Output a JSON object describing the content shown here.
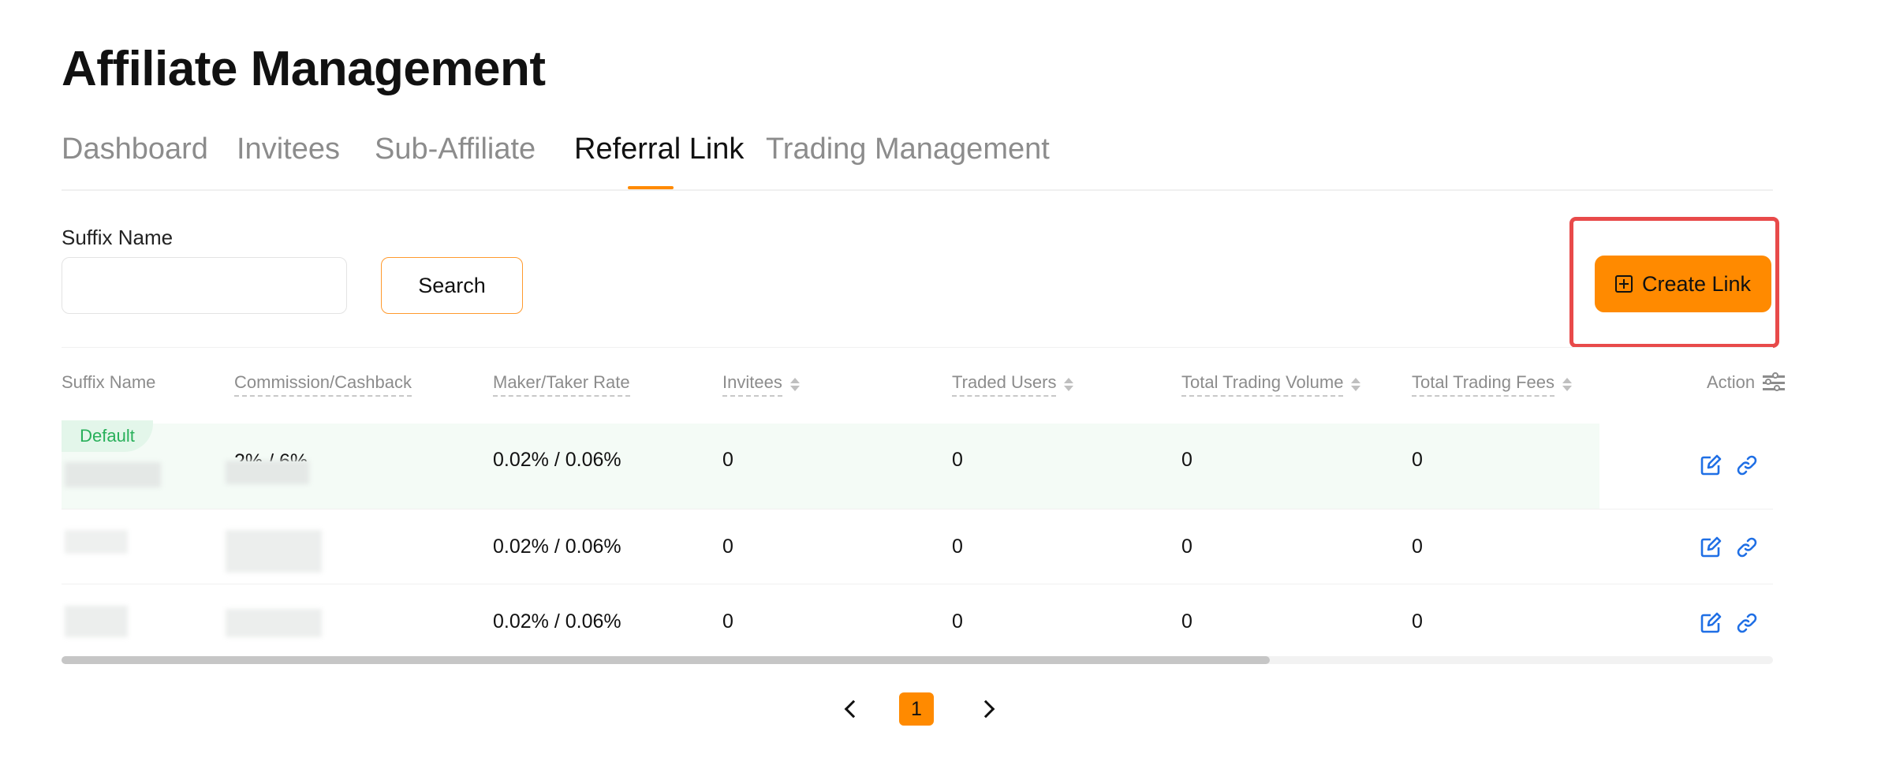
{
  "page": {
    "title": "Affiliate Management"
  },
  "tabs": [
    {
      "label": "Dashboard"
    },
    {
      "label": "Invitees"
    },
    {
      "label": "Sub-Affiliate"
    },
    {
      "label": "Referral Link"
    },
    {
      "label": "Trading Management"
    }
  ],
  "active_tab": "Referral Link",
  "filter": {
    "label": "Suffix Name",
    "value": "",
    "placeholder": "",
    "search_label": "Search"
  },
  "create_button": {
    "label": "Create Link",
    "icon": "plus-square-icon"
  },
  "table": {
    "columns": [
      {
        "label": "Suffix Name",
        "sortable": false
      },
      {
        "label": "Commission/Cashback",
        "sortable": false
      },
      {
        "label": "Maker/Taker Rate",
        "sortable": false
      },
      {
        "label": "Invitees",
        "sortable": true
      },
      {
        "label": "Traded Users",
        "sortable": true
      },
      {
        "label": "Total Trading Volume",
        "sortable": true
      },
      {
        "label": "Total Trading Fees",
        "sortable": true
      },
      {
        "label": "Action",
        "sortable": false
      }
    ],
    "default_badge": "Default",
    "rows": [
      {
        "commission": "2% / 6%",
        "rate": "0.02% / 0.06%",
        "invitees": "0",
        "traded_users": "0",
        "volume": "0",
        "fees": "0"
      },
      {
        "commission": "",
        "rate": "0.02% / 0.06%",
        "invitees": "0",
        "traded_users": "0",
        "volume": "0",
        "fees": "0"
      },
      {
        "commission": "",
        "rate": "0.02% / 0.06%",
        "invitees": "0",
        "traded_users": "0",
        "volume": "0",
        "fees": "0"
      }
    ]
  },
  "pagination": {
    "current_page": "1"
  },
  "colors": {
    "accent": "#ff8a00",
    "highlight": "#e84a4a",
    "default_badge": "#28b05a",
    "action_icon": "#1f6fe5"
  }
}
